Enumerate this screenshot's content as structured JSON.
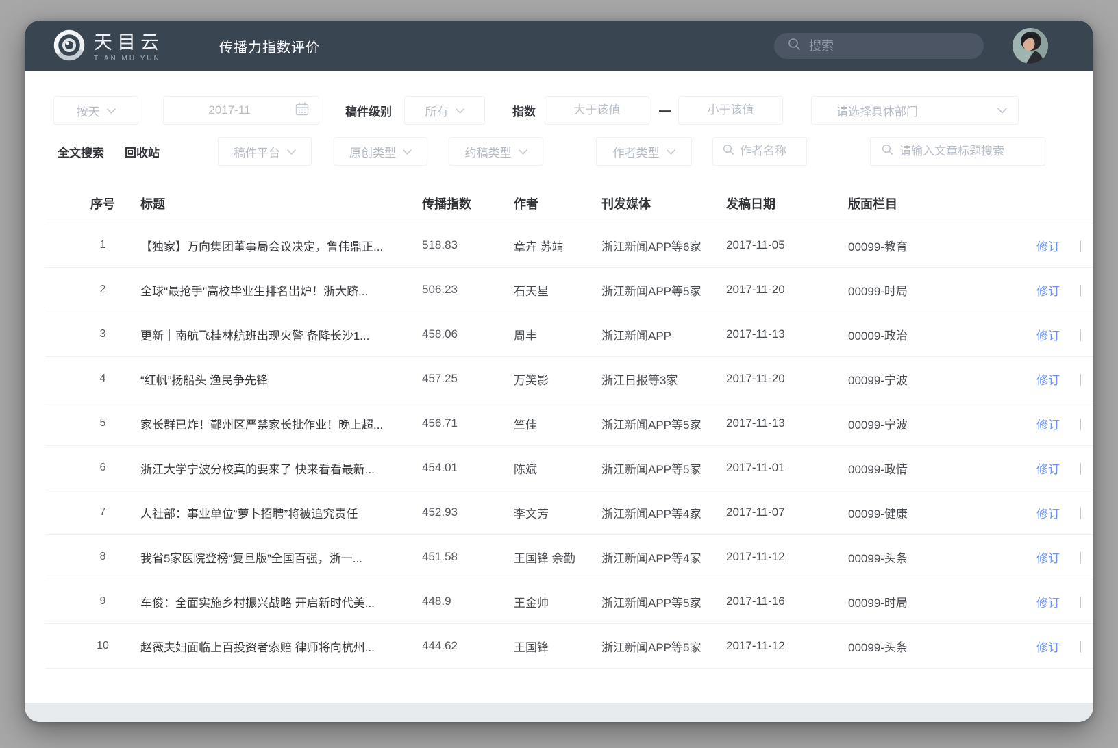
{
  "header": {
    "logo_title": "天目云",
    "logo_subtitle": "TIAN MU YUN",
    "page_title": "传播力指数评价",
    "search_placeholder": "搜索"
  },
  "filters": {
    "row1": {
      "period_select": "按天",
      "date_value": "2017-11",
      "level_label": "稿件级别",
      "level_select": "所有",
      "index_label": "指数",
      "index_min_placeholder": "大于该值",
      "range_dash": "—",
      "index_max_placeholder": "小于该值",
      "department_placeholder": "请选择具体部门"
    },
    "row2": {
      "fulltext_label": "全文搜索",
      "recycle_label": "回收站",
      "platform_select": "稿件平台",
      "original_select": "原创类型",
      "commission_select": "约稿类型",
      "author_type_select": "作者类型",
      "author_name_placeholder": "作者名称",
      "title_search_placeholder": "请输入文章标题搜索"
    }
  },
  "table": {
    "columns": [
      "序号",
      "标题",
      "传播指数",
      "作者",
      "刊发媒体",
      "发稿日期",
      "版面栏目"
    ],
    "action_label": "修订",
    "action_divider": "｜",
    "rows": [
      {
        "no": "1",
        "title": "【独家】万向集团董事局会议决定，鲁伟鼎正...",
        "index": "518.83",
        "author": "章卉 苏靖",
        "media": "浙江新闻APP等6家",
        "date": "2017-11-05",
        "section": "00099-教育"
      },
      {
        "no": "2",
        "title": "全球\"最抢手\"高校毕业生排名出炉！浙大跻...",
        "index": "506.23",
        "author": "石天星",
        "media": "浙江新闻APP等5家",
        "date": "2017-11-20",
        "section": "00099-时局"
      },
      {
        "no": "3",
        "title": "更新｜南航飞桂林航班出现火警 备降长沙1...",
        "index": "458.06",
        "author": "周丰",
        "media": "浙江新闻APP",
        "date": "2017-11-13",
        "section": "00009-政治"
      },
      {
        "no": "4",
        "title": "“红帆”扬船头 渔民争先锋",
        "index": "457.25",
        "author": "万笑影",
        "media": "浙江日报等3家",
        "date": "2017-11-20",
        "section": "00099-宁波"
      },
      {
        "no": "5",
        "title": "家长群已炸！鄞州区严禁家长批作业！晚上超...",
        "index": "456.71",
        "author": "竺佳",
        "media": "浙江新闻APP等5家",
        "date": "2017-11-13",
        "section": "00099-宁波"
      },
      {
        "no": "6",
        "title": "浙江大学宁波分校真的要来了 快来看看最新...",
        "index": "454.01",
        "author": "陈斌",
        "media": "浙江新闻APP等5家",
        "date": "2017-11-01",
        "section": "00099-政情"
      },
      {
        "no": "7",
        "title": "人社部：事业单位“萝卜招聘”将被追究责任",
        "index": "452.93",
        "author": "李文芳",
        "media": "浙江新闻APP等4家",
        "date": "2017-11-07",
        "section": "00099-健康"
      },
      {
        "no": "8",
        "title": "我省5家医院登榜“复旦版”全国百强，浙一...",
        "index": "451.58",
        "author": "王国锋 余勤",
        "media": "浙江新闻APP等4家",
        "date": "2017-11-12",
        "section": "00099-头条"
      },
      {
        "no": "9",
        "title": "车俊：全面实施乡村振兴战略 开启新时代美...",
        "index": "448.9",
        "author": "王金帅",
        "media": "浙江新闻APP等5家",
        "date": "2017-11-16",
        "section": "00099-时局"
      },
      {
        "no": "10",
        "title": "赵薇夫妇面临上百投资者索赔 律师将向杭州...",
        "index": "444.62",
        "author": "王国锋",
        "media": "浙江新闻APP等5家",
        "date": "2017-11-12",
        "section": "00099-头条"
      }
    ]
  },
  "colors": {
    "header_bg": "#3a4552",
    "link_blue": "#6e95f3"
  }
}
